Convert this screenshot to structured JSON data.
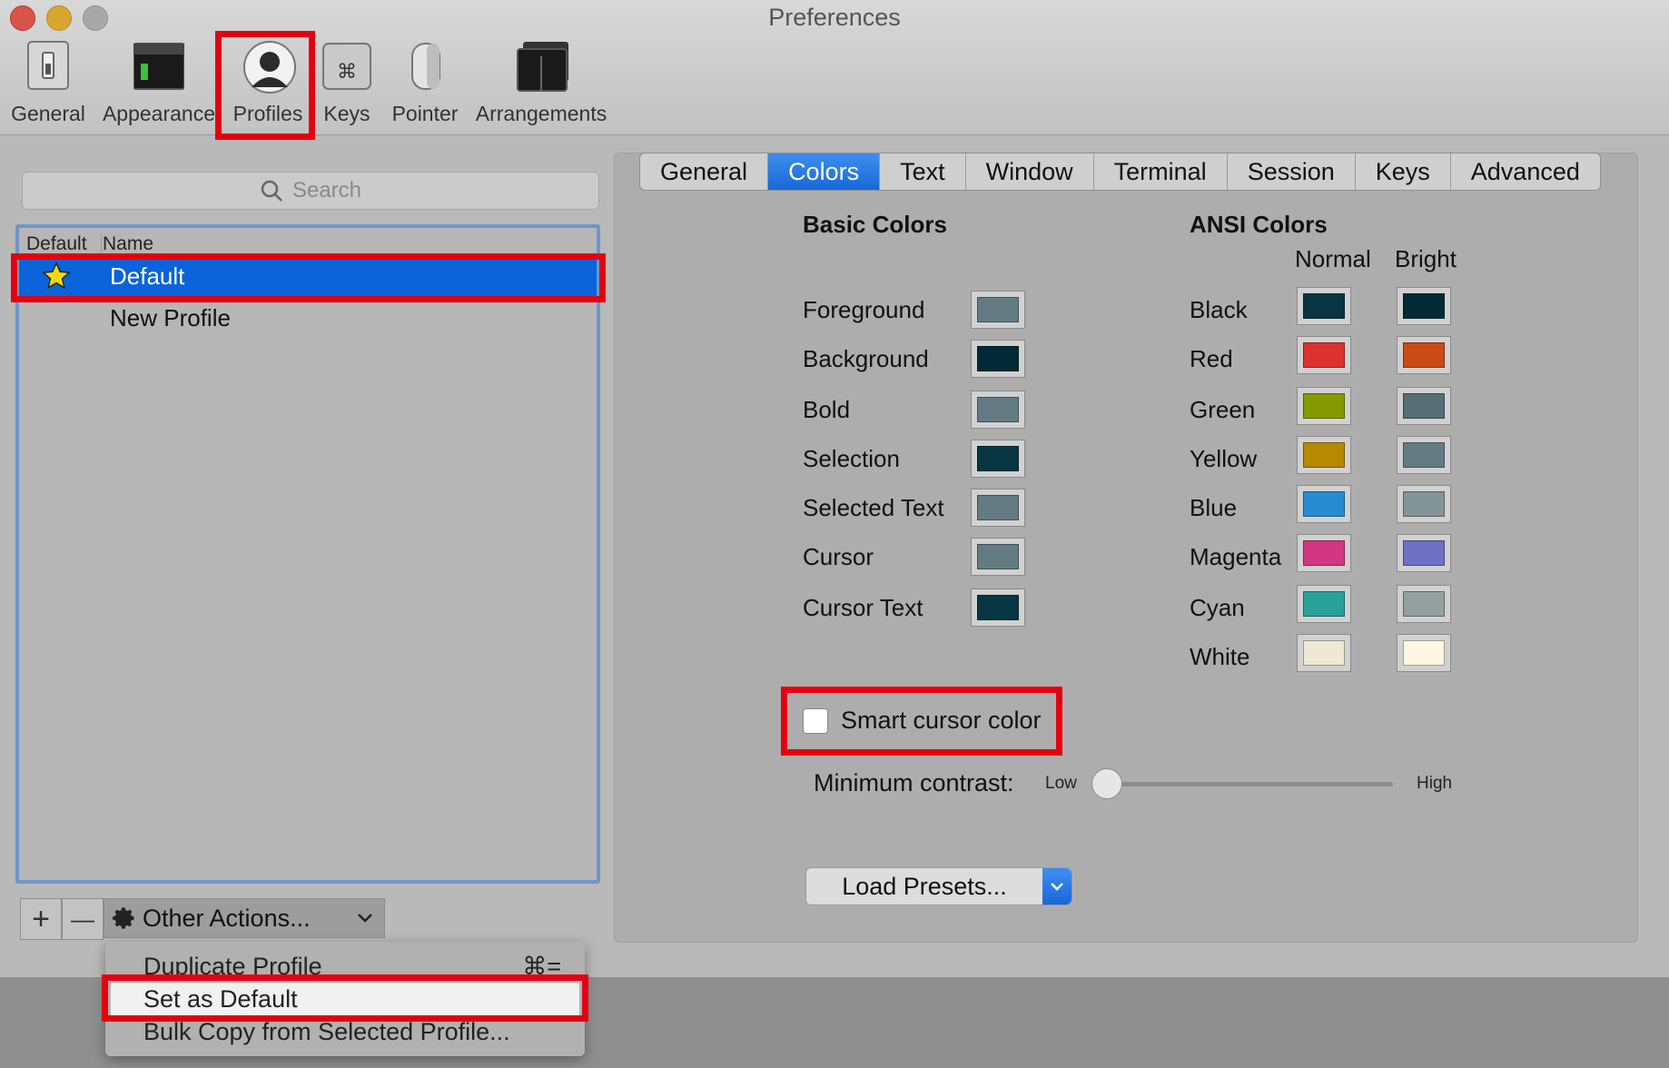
{
  "window": {
    "title": "Preferences"
  },
  "toolbar": {
    "items": [
      {
        "label": "General",
        "icon": "switch-icon"
      },
      {
        "label": "Appearance",
        "icon": "terminal-window-icon"
      },
      {
        "label": "Profiles",
        "icon": "user-silhouette-icon",
        "selected": true
      },
      {
        "label": "Keys",
        "icon": "command-key-icon"
      },
      {
        "label": "Pointer",
        "icon": "mouse-icon"
      },
      {
        "label": "Arrangements",
        "icon": "window-arrangement-icon"
      }
    ]
  },
  "search": {
    "placeholder": "Search"
  },
  "profiles": {
    "col_default": "Default",
    "col_name": "Name",
    "rows": [
      {
        "name": "Default",
        "is_default": true,
        "selected": true
      },
      {
        "name": "New Profile",
        "is_default": false,
        "selected": false
      }
    ]
  },
  "bottom_bar": {
    "add": "+",
    "remove": "—",
    "other_actions": "Other Actions..."
  },
  "other_actions_menu": {
    "duplicate": "Duplicate Profile",
    "duplicate_shortcut": "⌘=",
    "set_default": "Set as Default",
    "bulk_copy": "Bulk Copy from Selected Profile..."
  },
  "tabs": [
    "General",
    "Colors",
    "Text",
    "Window",
    "Terminal",
    "Session",
    "Keys",
    "Advanced"
  ],
  "active_tab": "Colors",
  "colors": {
    "basic_title": "Basic Colors",
    "ansi_title": "ANSI Colors",
    "normal_head": "Normal",
    "bright_head": "Bright",
    "basic": [
      {
        "label": "Foreground",
        "color": "#657b83"
      },
      {
        "label": "Background",
        "color": "#002b36"
      },
      {
        "label": "Bold",
        "color": "#657b83"
      },
      {
        "label": "Selection",
        "color": "#073642"
      },
      {
        "label": "Selected Text",
        "color": "#657b83"
      },
      {
        "label": "Cursor",
        "color": "#657b83"
      },
      {
        "label": "Cursor Text",
        "color": "#073642"
      }
    ],
    "ansi": [
      {
        "label": "Black",
        "normal": "#073642",
        "bright": "#002b36"
      },
      {
        "label": "Red",
        "normal": "#dc322f",
        "bright": "#cb4b16"
      },
      {
        "label": "Green",
        "normal": "#859900",
        "bright": "#586e75"
      },
      {
        "label": "Yellow",
        "normal": "#b58900",
        "bright": "#657b83"
      },
      {
        "label": "Blue",
        "normal": "#268bd2",
        "bright": "#839496"
      },
      {
        "label": "Magenta",
        "normal": "#d33682",
        "bright": "#6c71c4"
      },
      {
        "label": "Cyan",
        "normal": "#2aa198",
        "bright": "#93a1a1"
      },
      {
        "label": "White",
        "normal": "#eee8d5",
        "bright": "#fdf6e3"
      }
    ]
  },
  "smart_cursor": {
    "label": "Smart cursor color",
    "checked": false
  },
  "contrast": {
    "label": "Minimum contrast:",
    "low": "Low",
    "high": "High",
    "value": 0
  },
  "presets": {
    "label": "Load Presets..."
  },
  "accent": "#1868d8",
  "highlight": "#e30011"
}
